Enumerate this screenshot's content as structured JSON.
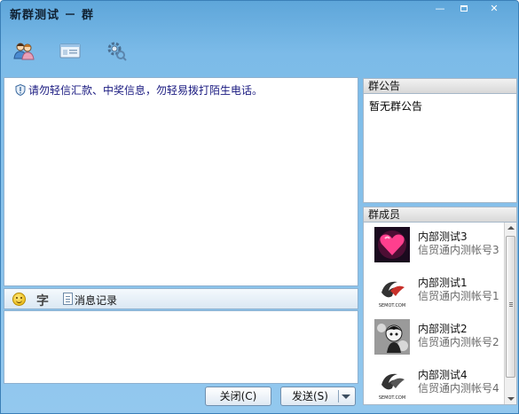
{
  "window": {
    "title": "新群测试 － 群",
    "controls": {
      "minimize": "—",
      "close": "✕"
    }
  },
  "toolbar": {
    "icons": [
      "group-members-icon",
      "card-icon",
      "settings-icon"
    ]
  },
  "chat": {
    "notice": "请勿轻信汇款、中奖信息，勿轻易拨打陌生电话。"
  },
  "input_toolbar": {
    "font_label": "字",
    "history_label": "消息记录"
  },
  "buttons": {
    "close_label": "关闭(C)",
    "send_label": "发送(S)"
  },
  "announcement": {
    "header": "群公告",
    "text": "暂无群公告"
  },
  "members": {
    "header": "群成员",
    "list": [
      {
        "name": "内部测试3",
        "sub": "信贸通内测帐号3",
        "avatar": "heart"
      },
      {
        "name": "内部测试1",
        "sub": "信贸通内测帐号1",
        "avatar": "semot"
      },
      {
        "name": "内部测试2",
        "sub": "信贸通内测帐号2",
        "avatar": "cartoon"
      },
      {
        "name": "内部测试4",
        "sub": "信贸通内测帐号4",
        "avatar": "semot"
      }
    ],
    "avatar_logo_text": "SEMOT.COM"
  },
  "colors": {
    "frame": "#7cbbe8",
    "notice_text": "#1a1a80"
  }
}
